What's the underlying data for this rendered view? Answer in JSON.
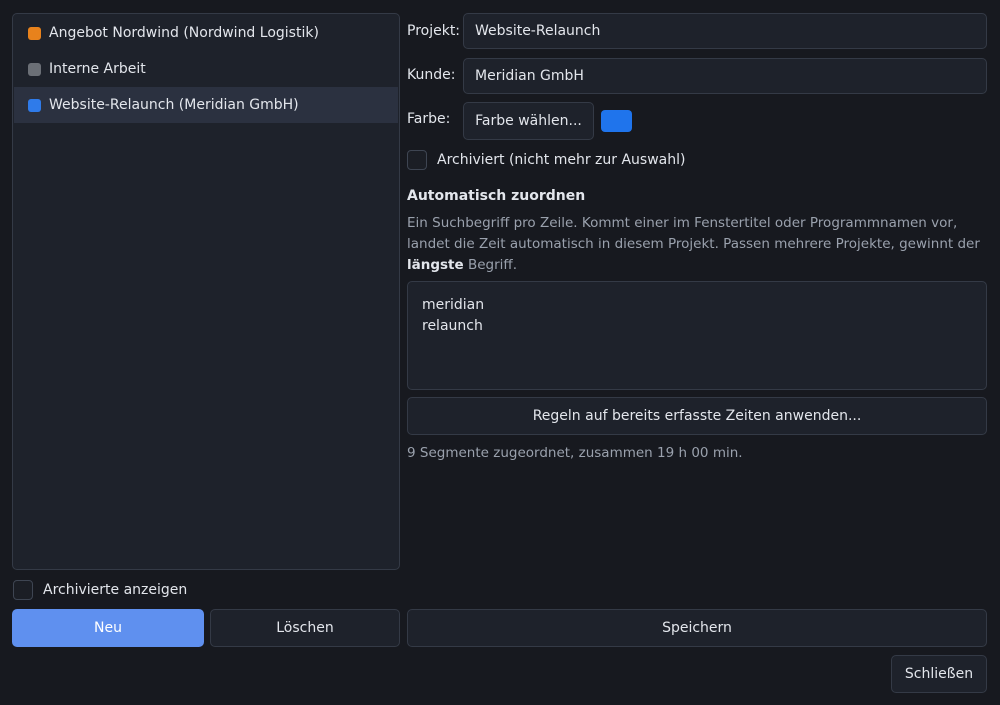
{
  "projects": [
    {
      "label": "Angebot Nordwind (Nordwind Logistik)",
      "color": "#e8821c",
      "selected": false
    },
    {
      "label": "Interne Arbeit",
      "color": "#6b6f76",
      "selected": false
    },
    {
      "label": "Website-Relaunch (Meridian GmbH)",
      "color": "#2f7bea",
      "selected": true
    }
  ],
  "show_archived": {
    "label": "Archivierte anzeigen",
    "checked": false
  },
  "buttons": {
    "new": "Neu",
    "delete": "Löschen",
    "save": "Speichern",
    "close": "Schließen",
    "choose_color": "Farbe wählen...",
    "apply_rules": "Regeln auf bereits erfasste Zeiten anwenden..."
  },
  "form": {
    "project_label": "Projekt:",
    "project_value": "Website-Relaunch",
    "client_label": "Kunde:",
    "client_value": "Meridian GmbH",
    "color_label": "Farbe:",
    "color_value": "#1f74ec",
    "archived_label": "Archiviert (nicht mehr zur Auswahl)",
    "archived_checked": false
  },
  "auto_assign": {
    "title": "Automatisch zuordnen",
    "description_before": "Ein Suchbegriff pro Zeile. Kommt einer im Fenstertitel oder Programmnamen vor, landet die Zeit automatisch in diesem Projekt. Passen mehrere Projekte, gewinnt der ",
    "description_bold": "längste",
    "description_after": " Begriff.",
    "rules": [
      "meridian",
      "relaunch"
    ]
  },
  "status": "9 Segmente zugeordnet, zusammen 19 h 00 min."
}
